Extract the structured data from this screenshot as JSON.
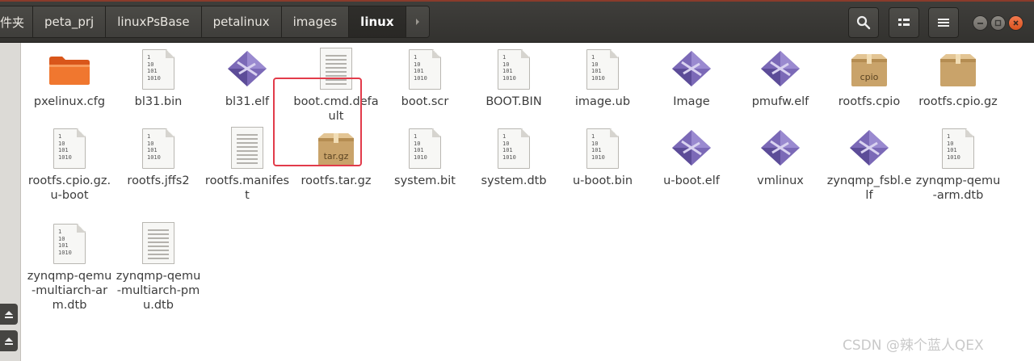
{
  "header": {
    "breadcrumbs": [
      {
        "label": "件夹",
        "active": false
      },
      {
        "label": "peta_prj",
        "active": false
      },
      {
        "label": "linuxPsBase",
        "active": false
      },
      {
        "label": "petalinux",
        "active": false
      },
      {
        "label": "images",
        "active": false
      },
      {
        "label": "linux",
        "active": true
      }
    ],
    "tools": [
      "search-icon",
      "view-options-icon",
      "menu-icon"
    ],
    "window_buttons": [
      "minimize",
      "maximize",
      "close"
    ]
  },
  "files": [
    {
      "name": "pxelinux.cfg",
      "icon": "folder"
    },
    {
      "name": "bl31.bin",
      "icon": "binary"
    },
    {
      "name": "bl31.elf",
      "icon": "executable"
    },
    {
      "name": "boot.cmd.default",
      "icon": "text"
    },
    {
      "name": "boot.scr",
      "icon": "binary"
    },
    {
      "name": "BOOT.BIN",
      "icon": "binary"
    },
    {
      "name": "image.ub",
      "icon": "binary"
    },
    {
      "name": "Image",
      "icon": "executable"
    },
    {
      "name": "pmufw.elf",
      "icon": "executable"
    },
    {
      "name": "rootfs.cpio",
      "icon": "archive",
      "badge": "cpio"
    },
    {
      "name": "rootfs.cpio.gz",
      "icon": "archive"
    },
    {
      "name": "rootfs.cpio.gz.u-boot",
      "icon": "binary"
    },
    {
      "name": "rootfs.jffs2",
      "icon": "binary"
    },
    {
      "name": "rootfs.manifest",
      "icon": "text"
    },
    {
      "name": "rootfs.tar.gz",
      "icon": "archive",
      "badge": "tar.gz",
      "selected": true
    },
    {
      "name": "system.bit",
      "icon": "binary"
    },
    {
      "name": "system.dtb",
      "icon": "binary"
    },
    {
      "name": "u-boot.bin",
      "icon": "binary"
    },
    {
      "name": "u-boot.elf",
      "icon": "executable"
    },
    {
      "name": "vmlinux",
      "icon": "executable"
    },
    {
      "name": "zynqmp_fsbl.elf",
      "icon": "executable"
    },
    {
      "name": "zynqmp-qemu-arm.dtb",
      "icon": "binary"
    },
    {
      "name": "zynqmp-qemu-multiarch-arm.dtb",
      "icon": "binary"
    },
    {
      "name": "zynqmp-qemu-multiarch-pmu.dtb",
      "icon": "text"
    }
  ],
  "binary_icon_text": [
    "1",
    "10",
    "101",
    "1010"
  ],
  "watermark": "CSDN @辣个蓝人QEX",
  "colors": {
    "selection_outline": "#e23b4a",
    "titlebar": "#3a3936"
  }
}
